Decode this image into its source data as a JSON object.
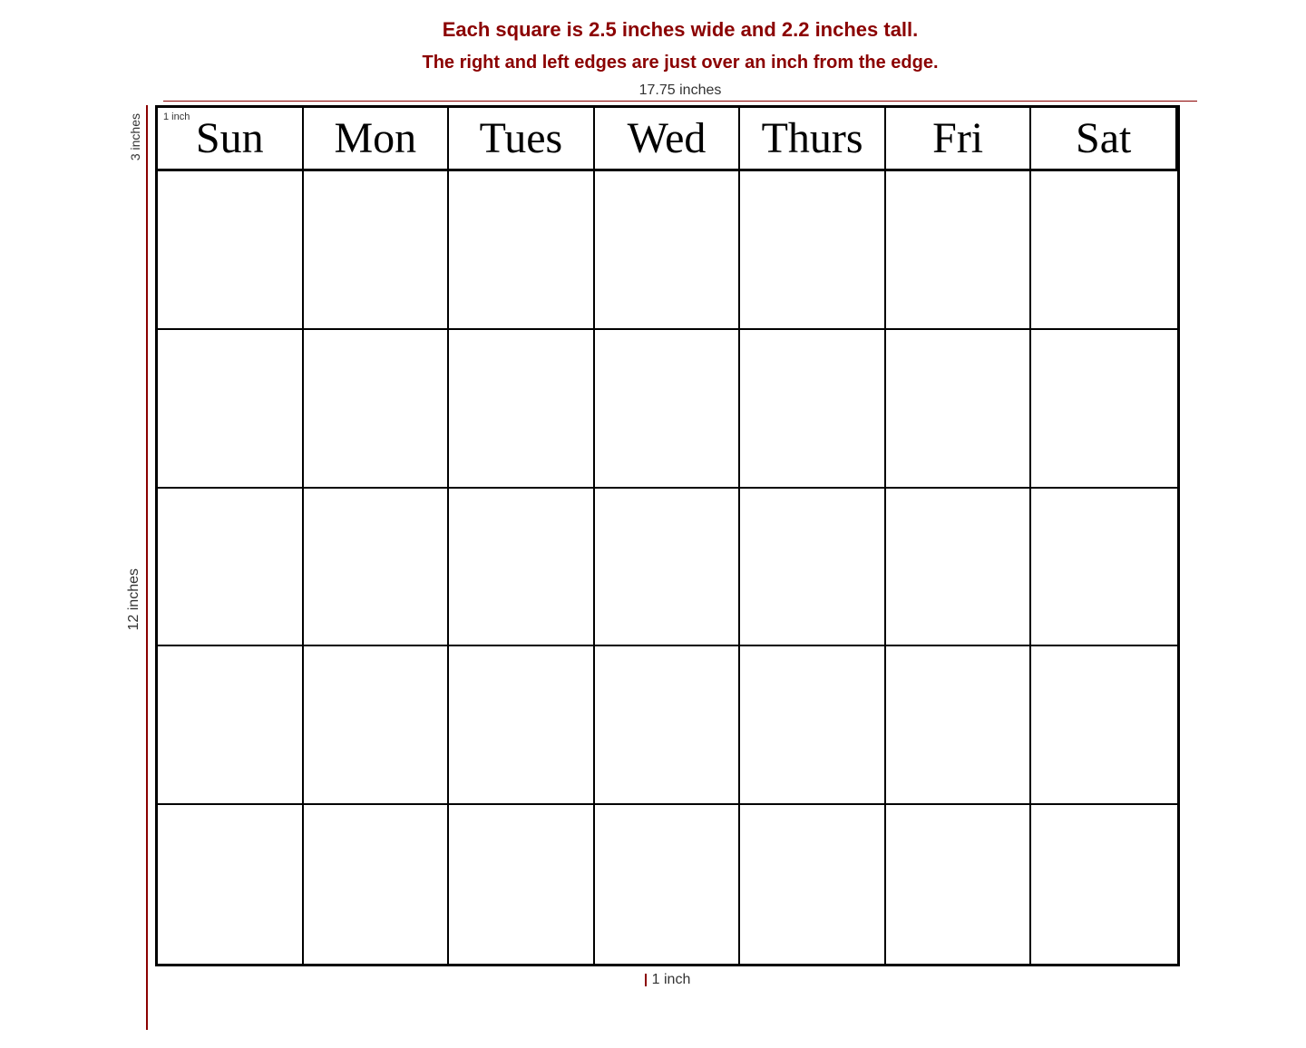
{
  "info": {
    "line1": "Each square is 2.5 inches wide and 2.2 inches tall.",
    "line2": "The right and left edges are just over an inch from the edge.",
    "width_label": "17.75 inches",
    "height_label_top": "3 inches",
    "height_label_main": "12 inches",
    "bottom_label": "1 inch"
  },
  "calendar": {
    "days": [
      "Sun",
      "Mon",
      "Tues",
      "Wed",
      "Thurs",
      "Fri",
      "Sat"
    ],
    "rows": 5,
    "inch_note": "1 inch"
  }
}
